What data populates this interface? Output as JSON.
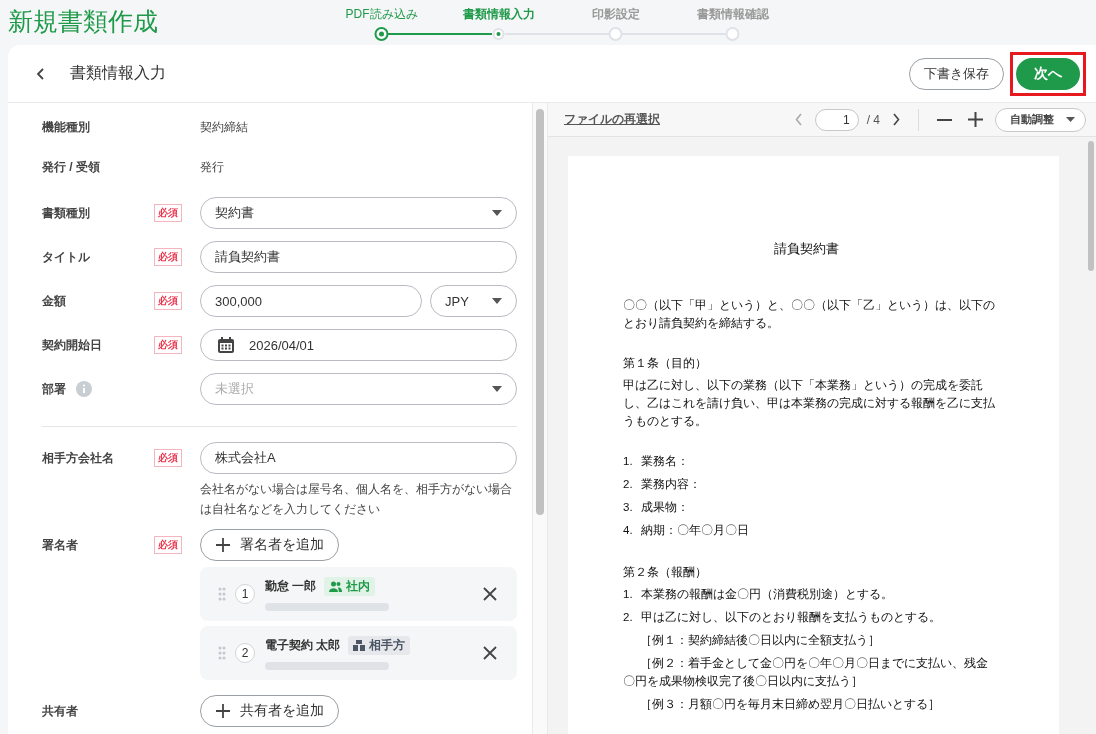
{
  "header": {
    "title": "新規書類作成"
  },
  "steps": [
    {
      "label": "PDF読み込み",
      "done": true,
      "selected": false
    },
    {
      "label": "書類情報入力",
      "done": false,
      "selected": true
    },
    {
      "label": "印影設定",
      "done": false,
      "selected": false
    },
    {
      "label": "書類情報確認",
      "done": false,
      "selected": false
    }
  ],
  "card": {
    "title": "書類情報入力",
    "draft_button": "下書き保存",
    "next_button": "次へ",
    "next_highlighted": true
  },
  "form": {
    "groups": [
      [
        {
          "kind": "static",
          "label": "機能種別",
          "value": "契約締結"
        },
        {
          "kind": "static",
          "label": "発行 / 受領",
          "value": "発行"
        },
        {
          "kind": "select",
          "label": "書類種別",
          "badge": "必須",
          "value": "契約書"
        },
        {
          "kind": "text",
          "label": "タイトル",
          "badge": "必須",
          "value": "請負契約書"
        },
        {
          "kind": "money",
          "label": "金額",
          "badge": "必須",
          "value": "300,000",
          "currency": "JPY"
        },
        {
          "kind": "date",
          "label": "契約開始日",
          "badge": "必須",
          "value": "2026/04/01"
        },
        {
          "kind": "select",
          "label": "部署",
          "info": true,
          "placeholder": "未選択"
        }
      ],
      [
        {
          "kind": "text",
          "label": "相手方会社名",
          "badge": "必須",
          "value": "株式会社A",
          "hint": "会社名がない場合は屋号名、個人名を、相手方がない場合は自社名などを入力してください"
        },
        {
          "kind": "signers",
          "label": "署名者",
          "badge": "必須",
          "add_button": "署名者を追加",
          "signers": [
            {
              "number": "1",
              "name": "勤怠 一郎",
              "tag": "社内",
              "internal": true
            },
            {
              "number": "2",
              "name": "電子契約 太郎",
              "tag": "相手方",
              "internal": false
            }
          ]
        },
        {
          "kind": "add",
          "label": "共有者",
          "add_button": "共有者を追加"
        }
      ]
    ]
  },
  "viewer": {
    "reselect_link": "ファイルの再選択",
    "page_input": "1",
    "page_total": "/ 4",
    "zoom_select": "自動調整",
    "document": {
      "title": "請負契約書",
      "blocks": [
        {
          "kind": "para",
          "text": "〇〇（以下「甲」という）と、〇〇（以下「乙」という）は、以下のとおり請負契約を締結する。"
        },
        {
          "kind": "heading",
          "text": "第１条（目的）"
        },
        {
          "kind": "para",
          "text": "甲は乙に対し、以下の業務（以下「本業務」という）の完成を委託し、乙はこれを請け負い、甲は本業務の完成に対する報酬を乙に支払うものとする。"
        },
        {
          "kind": "item",
          "number": "1.",
          "text": "業務名："
        },
        {
          "kind": "item",
          "number": "2.",
          "text": "業務内容："
        },
        {
          "kind": "item",
          "number": "3.",
          "text": "成果物："
        },
        {
          "kind": "item",
          "number": "4.",
          "text": "納期：〇年〇月〇日"
        },
        {
          "kind": "heading",
          "text": "第２条（報酬）"
        },
        {
          "kind": "item",
          "number": "1.",
          "text": "本業務の報酬は金〇円（消費税別途）とする。"
        },
        {
          "kind": "item",
          "number": "2.",
          "text": "甲は乙に対し、以下のとおり報酬を支払うものとする。"
        },
        {
          "kind": "example",
          "text": "［例１：契約締結後〇日以内に全額支払う］"
        },
        {
          "kind": "example",
          "text": "［例２：着手金として金〇円を〇年〇月〇日までに支払い、残金〇円を成果物検収完了後〇日以内に支払う］"
        },
        {
          "kind": "example",
          "text": "［例３：月額〇円を毎月末日締め翌月〇日払いとする］"
        }
      ]
    }
  }
}
